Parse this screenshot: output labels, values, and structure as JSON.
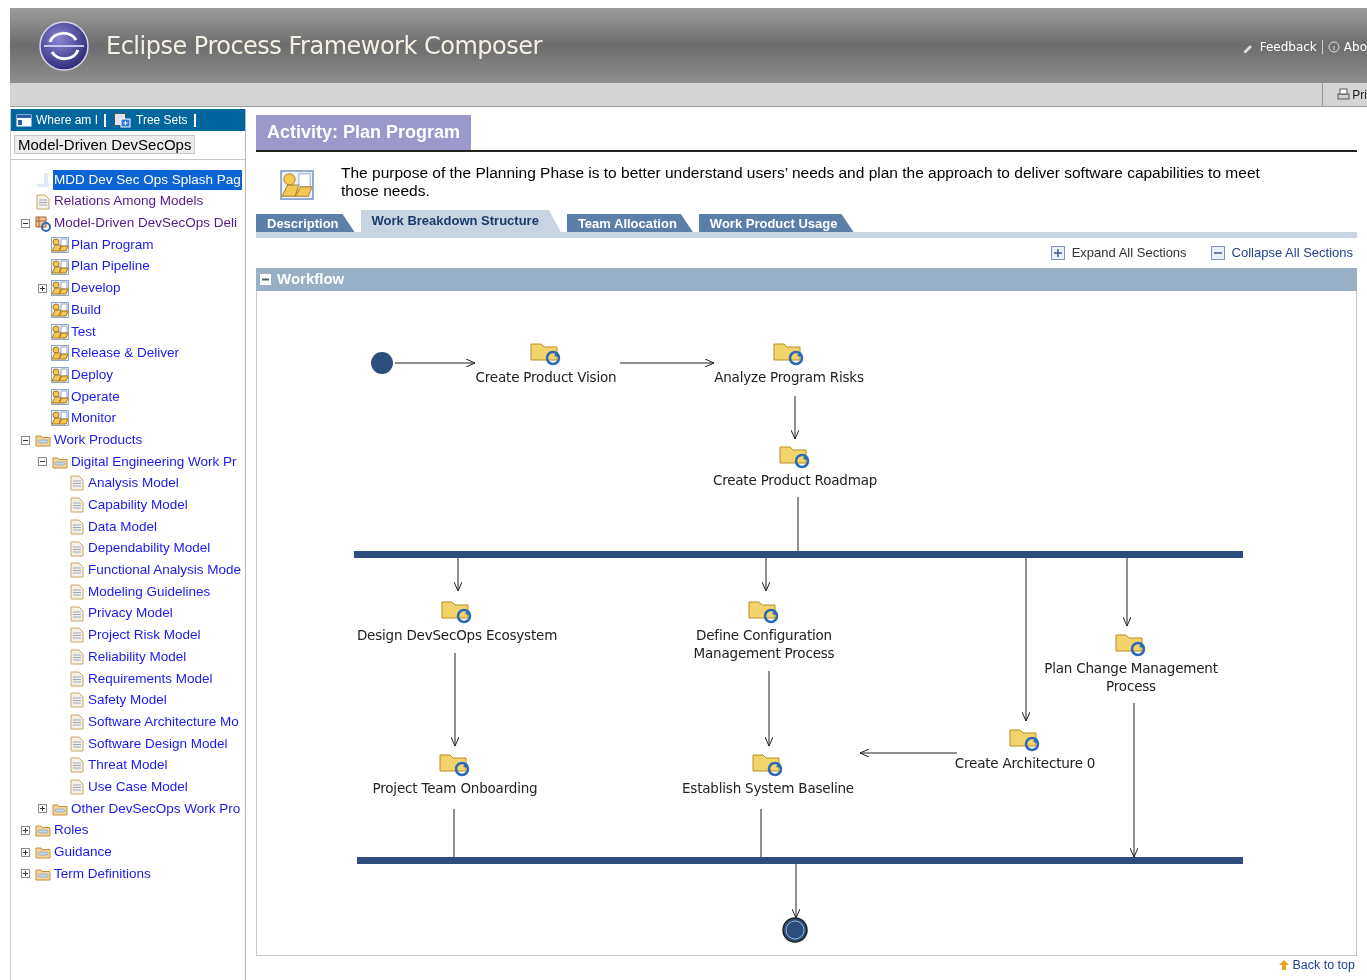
{
  "header": {
    "title": "Eclipse Process Framework Composer",
    "links": [
      {
        "kind": "feedback",
        "label": "Feedback"
      },
      {
        "kind": "about",
        "label": "Abo"
      }
    ]
  },
  "toolbar": {
    "print_label": "Pri"
  },
  "sidebar": {
    "nav": [
      {
        "kind": "where",
        "label": "Where am I"
      },
      {
        "kind": "treesets",
        "label": "Tree Sets"
      }
    ],
    "tree_set": "Model-Driven DevSecOps",
    "tree": [
      {
        "kind": "page",
        "label": "MDD Dev Sec Ops Splash Pag",
        "selected": true,
        "visited": false
      },
      {
        "kind": "doc",
        "label": "Relations Among Models",
        "selected": false,
        "visited": true
      },
      {
        "kind": "process",
        "label": "Model-Driven DevSecOps Deli",
        "selected": false,
        "visited": true,
        "expanded": true,
        "children": [
          {
            "kind": "activity",
            "label": "Plan Program",
            "selected": false,
            "visited": false
          },
          {
            "kind": "activity",
            "label": "Plan Pipeline",
            "selected": false,
            "visited": false
          },
          {
            "kind": "activity",
            "label": "Develop",
            "selected": false,
            "visited": false,
            "expanded": false
          },
          {
            "kind": "activity",
            "label": "Build",
            "selected": false,
            "visited": false
          },
          {
            "kind": "activity",
            "label": "Test",
            "selected": false,
            "visited": false
          },
          {
            "kind": "activity",
            "label": "Release & Deliver",
            "selected": false,
            "visited": false
          },
          {
            "kind": "activity",
            "label": "Deploy",
            "selected": false,
            "visited": false
          },
          {
            "kind": "activity",
            "label": "Operate",
            "selected": false,
            "visited": false
          },
          {
            "kind": "activity",
            "label": "Monitor",
            "selected": false,
            "visited": false
          }
        ]
      },
      {
        "kind": "folder",
        "label": "Work Products",
        "selected": false,
        "visited": false,
        "expanded": true,
        "children": [
          {
            "kind": "folder",
            "label": "Digital Engineering Work Pr",
            "selected": false,
            "visited": false,
            "expanded": true,
            "children": [
              {
                "kind": "doc",
                "label": "Analysis Model",
                "selected": false,
                "visited": false
              },
              {
                "kind": "doc",
                "label": "Capability Model",
                "selected": false,
                "visited": false
              },
              {
                "kind": "doc",
                "label": "Data Model",
                "selected": false,
                "visited": false
              },
              {
                "kind": "doc",
                "label": "Dependability Model",
                "selected": false,
                "visited": false
              },
              {
                "kind": "doc",
                "label": "Functional Analysis Mode",
                "selected": false,
                "visited": false
              },
              {
                "kind": "doc",
                "label": "Modeling Guidelines",
                "selected": false,
                "visited": false
              },
              {
                "kind": "doc",
                "label": "Privacy Model",
                "selected": false,
                "visited": false
              },
              {
                "kind": "doc",
                "label": "Project Risk Model",
                "selected": false,
                "visited": false
              },
              {
                "kind": "doc",
                "label": "Reliability Model",
                "selected": false,
                "visited": false
              },
              {
                "kind": "doc",
                "label": "Requirements Model",
                "selected": false,
                "visited": false
              },
              {
                "kind": "doc",
                "label": "Safety Model",
                "selected": false,
                "visited": false
              },
              {
                "kind": "doc",
                "label": "Software Architecture Mo",
                "selected": false,
                "visited": false
              },
              {
                "kind": "doc",
                "label": "Software Design Model",
                "selected": false,
                "visited": false
              },
              {
                "kind": "doc",
                "label": "Threat Model",
                "selected": false,
                "visited": false
              },
              {
                "kind": "doc",
                "label": "Use Case Model",
                "selected": false,
                "visited": false
              }
            ]
          },
          {
            "kind": "folder",
            "label": "Other DevSecOps Work Pro",
            "selected": false,
            "visited": false,
            "expanded": false
          }
        ]
      },
      {
        "kind": "folder",
        "label": "Roles",
        "selected": false,
        "visited": false,
        "expanded": false
      },
      {
        "kind": "folder",
        "label": "Guidance",
        "selected": false,
        "visited": false,
        "expanded": false
      },
      {
        "kind": "folder",
        "label": "Term Definitions",
        "selected": false,
        "visited": false,
        "expanded": false
      }
    ]
  },
  "content": {
    "title": "Activity: Plan Program",
    "description": "The purpose of the Planning Phase is to better understand users’ needs and plan the approach to deliver software capabilities to meet those needs.",
    "tabs": [
      {
        "label": "Description",
        "selected": false
      },
      {
        "label": "Work Breakdown Structure",
        "selected": true
      },
      {
        "label": "Team Allocation",
        "selected": false
      },
      {
        "label": "Work Product Usage",
        "selected": false
      }
    ],
    "expand_all": "Expand All Sections",
    "collapse_all": "Collapse All Sections",
    "section": {
      "title": "Workflow",
      "expanded": true
    },
    "workflow": {
      "tasks": [
        {
          "label": "Create Product Vision"
        },
        {
          "label": "Analyze Program Risks"
        },
        {
          "label": "Create Product Roadmap"
        },
        {
          "label": "Design DevSecOps Ecosystem"
        },
        {
          "label": "Define Configuration Management Process"
        },
        {
          "label": "Plan Change Management Process"
        },
        {
          "label": "Create Architecture 0"
        },
        {
          "label": "Project Team Onboarding"
        },
        {
          "label": "Establish System Baseline"
        }
      ]
    },
    "back_to_top": "Back to top"
  }
}
